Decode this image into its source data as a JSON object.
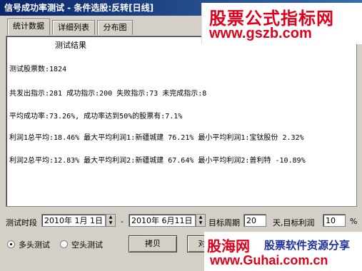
{
  "window": {
    "title": "信号成功率测试 - 条件选股:反转[日线]"
  },
  "tabs": [
    {
      "label": "统计数据",
      "active": true
    },
    {
      "label": "详细列表",
      "active": false
    },
    {
      "label": "分布图",
      "active": false
    }
  ],
  "results": {
    "heading": "测试结果",
    "lines": [
      "测试股票数:1824",
      "共发出指示:281 成功指示:200 失败指示:73 未完成指示:8",
      "平均成功率:73.26%, 成功率达到50%的股票有:7.1%",
      "利润1总平均:18.46% 最大平均利润1:新疆城建 76.21% 最小平均利润1:宝钛股份 2.32%",
      "利润2总平均:12.83% 最大平均利润2:新疆城建 67.64% 最小平均利润2:普利特   -10.89%"
    ]
  },
  "controls": {
    "period_label": "测试时段",
    "start_date": "2010年 1月 1日",
    "dash": "-",
    "end_date": "2010年 6月11日",
    "target_period_label": "目标周期",
    "target_period_value": "20",
    "target_profit_label": "天,目标利润",
    "target_profit_value": "10",
    "percent": "%",
    "radio_long": "多头测试",
    "radio_short": "空头测试",
    "copy_button": "拷贝",
    "second_button": "对"
  },
  "watermarks": {
    "top_title": "股票公式指标网",
    "top_url": "www.gszb.com",
    "bottom_logo": "股海网",
    "bottom_slogan": "股票软件资源分享",
    "bottom_url": "www.Guhai.com.cn"
  }
}
